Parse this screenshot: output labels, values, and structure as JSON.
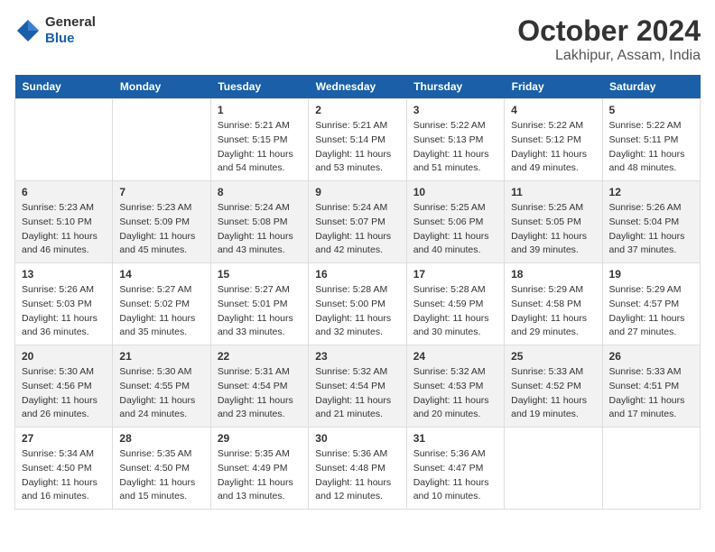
{
  "header": {
    "logo_general": "General",
    "logo_blue": "Blue",
    "title": "October 2024",
    "subtitle": "Lakhipur, Assam, India"
  },
  "calendar": {
    "days_of_week": [
      "Sunday",
      "Monday",
      "Tuesday",
      "Wednesday",
      "Thursday",
      "Friday",
      "Saturday"
    ],
    "weeks": [
      [
        {
          "num": "",
          "empty": true
        },
        {
          "num": "",
          "empty": true
        },
        {
          "num": "1",
          "sunrise": "5:21 AM",
          "sunset": "5:15 PM",
          "daylight": "11 hours and 54 minutes."
        },
        {
          "num": "2",
          "sunrise": "5:21 AM",
          "sunset": "5:14 PM",
          "daylight": "11 hours and 53 minutes."
        },
        {
          "num": "3",
          "sunrise": "5:22 AM",
          "sunset": "5:13 PM",
          "daylight": "11 hours and 51 minutes."
        },
        {
          "num": "4",
          "sunrise": "5:22 AM",
          "sunset": "5:12 PM",
          "daylight": "11 hours and 49 minutes."
        },
        {
          "num": "5",
          "sunrise": "5:22 AM",
          "sunset": "5:11 PM",
          "daylight": "11 hours and 48 minutes."
        }
      ],
      [
        {
          "num": "6",
          "sunrise": "5:23 AM",
          "sunset": "5:10 PM",
          "daylight": "11 hours and 46 minutes."
        },
        {
          "num": "7",
          "sunrise": "5:23 AM",
          "sunset": "5:09 PM",
          "daylight": "11 hours and 45 minutes."
        },
        {
          "num": "8",
          "sunrise": "5:24 AM",
          "sunset": "5:08 PM",
          "daylight": "11 hours and 43 minutes."
        },
        {
          "num": "9",
          "sunrise": "5:24 AM",
          "sunset": "5:07 PM",
          "daylight": "11 hours and 42 minutes."
        },
        {
          "num": "10",
          "sunrise": "5:25 AM",
          "sunset": "5:06 PM",
          "daylight": "11 hours and 40 minutes."
        },
        {
          "num": "11",
          "sunrise": "5:25 AM",
          "sunset": "5:05 PM",
          "daylight": "11 hours and 39 minutes."
        },
        {
          "num": "12",
          "sunrise": "5:26 AM",
          "sunset": "5:04 PM",
          "daylight": "11 hours and 37 minutes."
        }
      ],
      [
        {
          "num": "13",
          "sunrise": "5:26 AM",
          "sunset": "5:03 PM",
          "daylight": "11 hours and 36 minutes."
        },
        {
          "num": "14",
          "sunrise": "5:27 AM",
          "sunset": "5:02 PM",
          "daylight": "11 hours and 35 minutes."
        },
        {
          "num": "15",
          "sunrise": "5:27 AM",
          "sunset": "5:01 PM",
          "daylight": "11 hours and 33 minutes."
        },
        {
          "num": "16",
          "sunrise": "5:28 AM",
          "sunset": "5:00 PM",
          "daylight": "11 hours and 32 minutes."
        },
        {
          "num": "17",
          "sunrise": "5:28 AM",
          "sunset": "4:59 PM",
          "daylight": "11 hours and 30 minutes."
        },
        {
          "num": "18",
          "sunrise": "5:29 AM",
          "sunset": "4:58 PM",
          "daylight": "11 hours and 29 minutes."
        },
        {
          "num": "19",
          "sunrise": "5:29 AM",
          "sunset": "4:57 PM",
          "daylight": "11 hours and 27 minutes."
        }
      ],
      [
        {
          "num": "20",
          "sunrise": "5:30 AM",
          "sunset": "4:56 PM",
          "daylight": "11 hours and 26 minutes."
        },
        {
          "num": "21",
          "sunrise": "5:30 AM",
          "sunset": "4:55 PM",
          "daylight": "11 hours and 24 minutes."
        },
        {
          "num": "22",
          "sunrise": "5:31 AM",
          "sunset": "4:54 PM",
          "daylight": "11 hours and 23 minutes."
        },
        {
          "num": "23",
          "sunrise": "5:32 AM",
          "sunset": "4:54 PM",
          "daylight": "11 hours and 21 minutes."
        },
        {
          "num": "24",
          "sunrise": "5:32 AM",
          "sunset": "4:53 PM",
          "daylight": "11 hours and 20 minutes."
        },
        {
          "num": "25",
          "sunrise": "5:33 AM",
          "sunset": "4:52 PM",
          "daylight": "11 hours and 19 minutes."
        },
        {
          "num": "26",
          "sunrise": "5:33 AM",
          "sunset": "4:51 PM",
          "daylight": "11 hours and 17 minutes."
        }
      ],
      [
        {
          "num": "27",
          "sunrise": "5:34 AM",
          "sunset": "4:50 PM",
          "daylight": "11 hours and 16 minutes."
        },
        {
          "num": "28",
          "sunrise": "5:35 AM",
          "sunset": "4:50 PM",
          "daylight": "11 hours and 15 minutes."
        },
        {
          "num": "29",
          "sunrise": "5:35 AM",
          "sunset": "4:49 PM",
          "daylight": "11 hours and 13 minutes."
        },
        {
          "num": "30",
          "sunrise": "5:36 AM",
          "sunset": "4:48 PM",
          "daylight": "11 hours and 12 minutes."
        },
        {
          "num": "31",
          "sunrise": "5:36 AM",
          "sunset": "4:47 PM",
          "daylight": "11 hours and 10 minutes."
        },
        {
          "num": "",
          "empty": true
        },
        {
          "num": "",
          "empty": true
        }
      ]
    ]
  }
}
